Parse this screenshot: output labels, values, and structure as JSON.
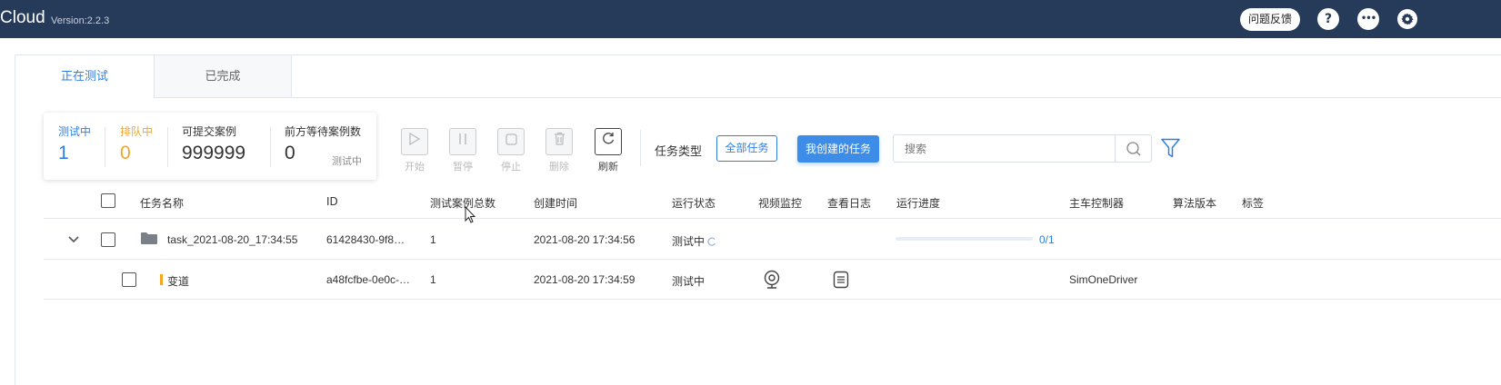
{
  "header": {
    "brand": "Cloud",
    "version": "Version:2.2.3",
    "feedback_label": "问题反馈",
    "help_label": "?",
    "more_label": "•••",
    "settings_icon": "gear-icon"
  },
  "tabs": [
    {
      "label": "正在测试",
      "active": true
    },
    {
      "label": "已完成",
      "active": false
    }
  ],
  "stats": {
    "testing": {
      "label": "测试中",
      "value": "1",
      "color": "#2f7fe0"
    },
    "queued": {
      "label": "排队中",
      "value": "0",
      "color": "#f5a623"
    },
    "submittable": {
      "label": "可提交案例",
      "value": "999999"
    },
    "waiting": {
      "label": "前方等待案例数",
      "value": "0",
      "sub": "测试中"
    }
  },
  "toolbar": {
    "start": "开始",
    "pause": "暂停",
    "stop": "停止",
    "delete": "删除",
    "refresh": "刷新",
    "task_type_label": "任务类型",
    "all_tasks": "全部任务",
    "my_tasks": "我创建的任务",
    "search_placeholder": "搜索"
  },
  "table": {
    "columns": [
      "任务名称",
      "ID",
      "测试案例总数",
      "创建时间",
      "运行状态",
      "视频监控",
      "查看日志",
      "运行进度",
      "主车控制器",
      "算法版本",
      "标签"
    ],
    "rows": [
      {
        "name": "task_2021-08-20_17:34:55",
        "id": "61428430-9f8…",
        "total": "1",
        "created": "2021-08-20 17:34:56",
        "status": "测试中",
        "progress_text": "0/1",
        "progress": 0,
        "controller": ""
      },
      {
        "name": "变道",
        "id": "a48fcfbe-0e0c-…",
        "total": "1",
        "created": "2021-08-20 17:34:59",
        "status": "测试中",
        "controller": "SimOneDriver"
      }
    ]
  }
}
